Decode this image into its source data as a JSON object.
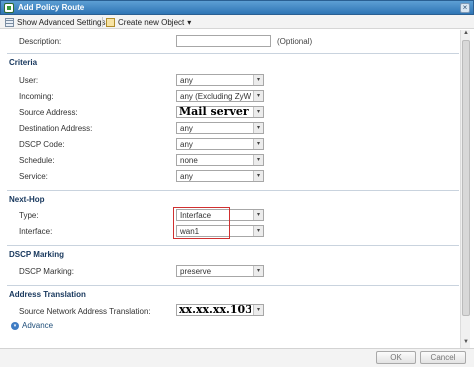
{
  "window": {
    "title": "Add Policy Route",
    "close_glyph": "×"
  },
  "toolbar": {
    "show_advanced_label": "Show Advanced Settings",
    "create_object_label": "Create new Object",
    "create_object_caret": "▾"
  },
  "description": {
    "label": "Description:",
    "value": "",
    "hint": "(Optional)"
  },
  "criteria": {
    "title": "Criteria",
    "fields": [
      {
        "label": "User:",
        "value": "any"
      },
      {
        "label": "Incoming:",
        "value": "any (Excluding ZyWALL)"
      },
      {
        "label": "Source Address:",
        "value": "Mail server IP"
      },
      {
        "label": "Destination Address:",
        "value": "any"
      },
      {
        "label": "DSCP Code:",
        "value": "any"
      },
      {
        "label": "Schedule:",
        "value": "none"
      },
      {
        "label": "Service:",
        "value": "any"
      }
    ]
  },
  "next_hop": {
    "title": "Next-Hop",
    "fields": [
      {
        "label": "Type:",
        "value": "Interface"
      },
      {
        "label": "Interface:",
        "value": "wan1"
      }
    ],
    "highlight_color": "#d03030"
  },
  "dscp_marking": {
    "title": "DSCP Marking",
    "fields": [
      {
        "label": "DSCP Marking:",
        "value": "preserve"
      }
    ]
  },
  "address_translation": {
    "title": "Address Translation",
    "fields": [
      {
        "label": "Source Network Address Translation:",
        "value": "xx.xx.xx.103"
      }
    ]
  },
  "advance": {
    "label": "Advance",
    "icon": "▾"
  },
  "scroll": {
    "up": "▲",
    "down": "▼"
  },
  "dropdown_arrow": "▾",
  "buttons": {
    "ok": "OK",
    "cancel": "Cancel"
  },
  "colors": {
    "title_bar": "#2f75b5",
    "section_title": "#16365c"
  }
}
